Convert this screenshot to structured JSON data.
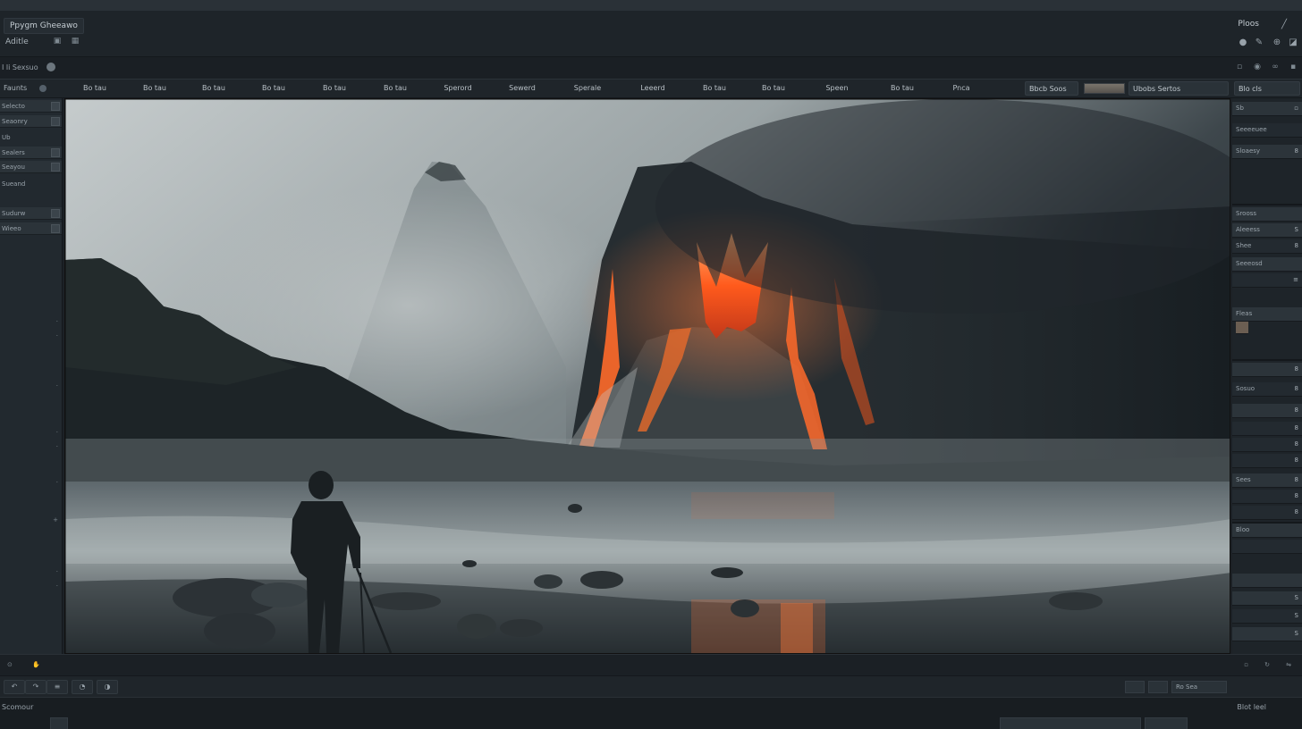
{
  "header": {
    "app_title": "Ppygm Gheeawo",
    "menu_label": "Aditle",
    "right_title": "Ploos"
  },
  "subbar": {
    "label": "I li Sexsuo"
  },
  "toolbar": {
    "left_label": "Faunts",
    "tabs": [
      "Bo tau",
      "Bo tau",
      "Bo tau",
      "Bo tau",
      "Bo tau",
      "Bo tau",
      "Sperord",
      "Sewerd",
      "Sperale",
      "Leeerd",
      "Bo tau",
      "Bo tau",
      "Speen",
      "Bo tau",
      "Pnca"
    ],
    "field_a": "Bbcb Soos",
    "field_b": "Ubobs Sertos",
    "field_c": "Blo cls"
  },
  "left_panel": {
    "rows": [
      "Selecto",
      "Seaonry",
      "Ub",
      "Sealers",
      "Seayou",
      "Sueand",
      "Sudurw",
      "Wieeo"
    ]
  },
  "right_panel": {
    "rows": [
      "Sb",
      "Seeeeuee",
      "Sloaesy",
      "Srooss",
      "Aleeess",
      "Shee",
      "Seeeosd",
      "Fleas",
      "Sosuo",
      "Sees",
      "Bloo"
    ]
  },
  "status": {
    "footer_label": "Scomour",
    "footer_right": "Blot leel",
    "status_right": "Ro Sea"
  }
}
